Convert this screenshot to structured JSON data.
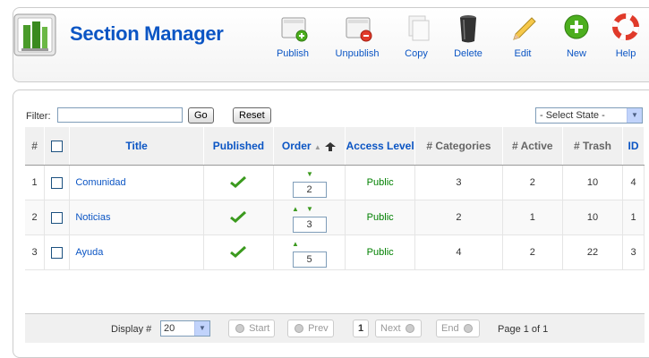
{
  "header": {
    "title": "Section Manager"
  },
  "toolbar": {
    "publish": "Publish",
    "unpublish": "Unpublish",
    "copy": "Copy",
    "delete": "Delete",
    "edit": "Edit",
    "new": "New",
    "help": "Help"
  },
  "filter": {
    "label": "Filter:",
    "value": "",
    "go": "Go",
    "reset": "Reset",
    "state_selected": "- Select State -"
  },
  "table": {
    "columns": [
      "#",
      "",
      "Title",
      "Published",
      "Order",
      "Access Level",
      "# Categories",
      "# Active",
      "# Trash",
      "ID"
    ],
    "rows": [
      {
        "num": "1",
        "title": "Comunidad",
        "order": "2",
        "access": "Public",
        "categories": "3",
        "active": "2",
        "trash": "10",
        "id": "4"
      },
      {
        "num": "2",
        "title": "Noticias",
        "order": "3",
        "access": "Public",
        "categories": "2",
        "active": "1",
        "trash": "10",
        "id": "1"
      },
      {
        "num": "3",
        "title": "Ayuda",
        "order": "5",
        "access": "Public",
        "categories": "4",
        "active": "2",
        "trash": "22",
        "id": "3"
      }
    ]
  },
  "footer": {
    "display_label": "Display #",
    "display_value": "20",
    "start": "Start",
    "prev": "Prev",
    "current_page": "1",
    "next": "Next",
    "end": "End",
    "page_info": "Page 1 of 1"
  },
  "colors": {
    "link": "#0b55c4",
    "published_check": "#3b9a1e",
    "header_bg": "#f0f0f0"
  }
}
